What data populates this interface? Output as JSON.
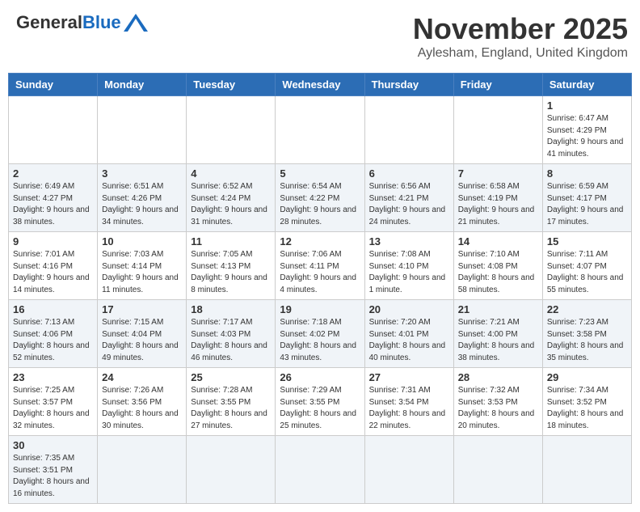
{
  "header": {
    "logo_general": "General",
    "logo_blue": "Blue",
    "month_title": "November 2025",
    "location": "Aylesham, England, United Kingdom"
  },
  "weekdays": [
    "Sunday",
    "Monday",
    "Tuesday",
    "Wednesday",
    "Thursday",
    "Friday",
    "Saturday"
  ],
  "weeks": [
    [
      {
        "day": "",
        "info": ""
      },
      {
        "day": "",
        "info": ""
      },
      {
        "day": "",
        "info": ""
      },
      {
        "day": "",
        "info": ""
      },
      {
        "day": "",
        "info": ""
      },
      {
        "day": "",
        "info": ""
      },
      {
        "day": "1",
        "info": "Sunrise: 6:47 AM\nSunset: 4:29 PM\nDaylight: 9 hours and 41 minutes."
      }
    ],
    [
      {
        "day": "2",
        "info": "Sunrise: 6:49 AM\nSunset: 4:27 PM\nDaylight: 9 hours and 38 minutes."
      },
      {
        "day": "3",
        "info": "Sunrise: 6:51 AM\nSunset: 4:26 PM\nDaylight: 9 hours and 34 minutes."
      },
      {
        "day": "4",
        "info": "Sunrise: 6:52 AM\nSunset: 4:24 PM\nDaylight: 9 hours and 31 minutes."
      },
      {
        "day": "5",
        "info": "Sunrise: 6:54 AM\nSunset: 4:22 PM\nDaylight: 9 hours and 28 minutes."
      },
      {
        "day": "6",
        "info": "Sunrise: 6:56 AM\nSunset: 4:21 PM\nDaylight: 9 hours and 24 minutes."
      },
      {
        "day": "7",
        "info": "Sunrise: 6:58 AM\nSunset: 4:19 PM\nDaylight: 9 hours and 21 minutes."
      },
      {
        "day": "8",
        "info": "Sunrise: 6:59 AM\nSunset: 4:17 PM\nDaylight: 9 hours and 17 minutes."
      }
    ],
    [
      {
        "day": "9",
        "info": "Sunrise: 7:01 AM\nSunset: 4:16 PM\nDaylight: 9 hours and 14 minutes."
      },
      {
        "day": "10",
        "info": "Sunrise: 7:03 AM\nSunset: 4:14 PM\nDaylight: 9 hours and 11 minutes."
      },
      {
        "day": "11",
        "info": "Sunrise: 7:05 AM\nSunset: 4:13 PM\nDaylight: 9 hours and 8 minutes."
      },
      {
        "day": "12",
        "info": "Sunrise: 7:06 AM\nSunset: 4:11 PM\nDaylight: 9 hours and 4 minutes."
      },
      {
        "day": "13",
        "info": "Sunrise: 7:08 AM\nSunset: 4:10 PM\nDaylight: 9 hours and 1 minute."
      },
      {
        "day": "14",
        "info": "Sunrise: 7:10 AM\nSunset: 4:08 PM\nDaylight: 8 hours and 58 minutes."
      },
      {
        "day": "15",
        "info": "Sunrise: 7:11 AM\nSunset: 4:07 PM\nDaylight: 8 hours and 55 minutes."
      }
    ],
    [
      {
        "day": "16",
        "info": "Sunrise: 7:13 AM\nSunset: 4:06 PM\nDaylight: 8 hours and 52 minutes."
      },
      {
        "day": "17",
        "info": "Sunrise: 7:15 AM\nSunset: 4:04 PM\nDaylight: 8 hours and 49 minutes."
      },
      {
        "day": "18",
        "info": "Sunrise: 7:17 AM\nSunset: 4:03 PM\nDaylight: 8 hours and 46 minutes."
      },
      {
        "day": "19",
        "info": "Sunrise: 7:18 AM\nSunset: 4:02 PM\nDaylight: 8 hours and 43 minutes."
      },
      {
        "day": "20",
        "info": "Sunrise: 7:20 AM\nSunset: 4:01 PM\nDaylight: 8 hours and 40 minutes."
      },
      {
        "day": "21",
        "info": "Sunrise: 7:21 AM\nSunset: 4:00 PM\nDaylight: 8 hours and 38 minutes."
      },
      {
        "day": "22",
        "info": "Sunrise: 7:23 AM\nSunset: 3:58 PM\nDaylight: 8 hours and 35 minutes."
      }
    ],
    [
      {
        "day": "23",
        "info": "Sunrise: 7:25 AM\nSunset: 3:57 PM\nDaylight: 8 hours and 32 minutes."
      },
      {
        "day": "24",
        "info": "Sunrise: 7:26 AM\nSunset: 3:56 PM\nDaylight: 8 hours and 30 minutes."
      },
      {
        "day": "25",
        "info": "Sunrise: 7:28 AM\nSunset: 3:55 PM\nDaylight: 8 hours and 27 minutes."
      },
      {
        "day": "26",
        "info": "Sunrise: 7:29 AM\nSunset: 3:55 PM\nDaylight: 8 hours and 25 minutes."
      },
      {
        "day": "27",
        "info": "Sunrise: 7:31 AM\nSunset: 3:54 PM\nDaylight: 8 hours and 22 minutes."
      },
      {
        "day": "28",
        "info": "Sunrise: 7:32 AM\nSunset: 3:53 PM\nDaylight: 8 hours and 20 minutes."
      },
      {
        "day": "29",
        "info": "Sunrise: 7:34 AM\nSunset: 3:52 PM\nDaylight: 8 hours and 18 minutes."
      }
    ],
    [
      {
        "day": "30",
        "info": "Sunrise: 7:35 AM\nSunset: 3:51 PM\nDaylight: 8 hours and 16 minutes."
      },
      {
        "day": "",
        "info": ""
      },
      {
        "day": "",
        "info": ""
      },
      {
        "day": "",
        "info": ""
      },
      {
        "day": "",
        "info": ""
      },
      {
        "day": "",
        "info": ""
      },
      {
        "day": "",
        "info": ""
      }
    ]
  ]
}
